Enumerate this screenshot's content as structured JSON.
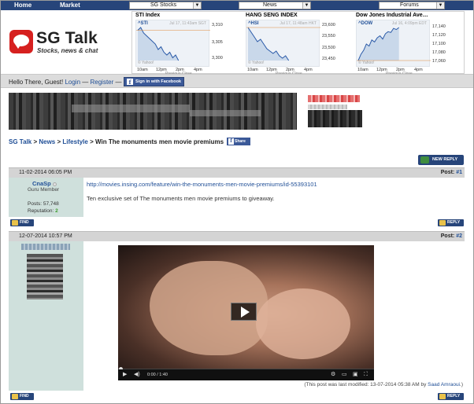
{
  "nav": {
    "home": "Home",
    "market": "Market",
    "dropdowns": [
      "SG Stocks",
      "News",
      "Forums"
    ]
  },
  "logo": {
    "title": "SG Talk",
    "tagline": "Stocks, news & chat"
  },
  "tickers": [
    {
      "title": "STI Index",
      "symbol": "^STI",
      "time": "Jul 17, 11:43am SGT",
      "y_ticks": [
        "3,310",
        "3,305",
        "3,300"
      ],
      "x_ticks": [
        "10am",
        "12pm",
        "2pm",
        "4pm"
      ],
      "prev_close": "Previous Close",
      "source": "© Yahoo!",
      "series": [
        3309,
        3310,
        3308,
        3307,
        3306,
        3305,
        3304,
        3302,
        3303,
        3301,
        3300,
        3301,
        3299,
        3300,
        3298
      ]
    },
    {
      "title": "HANG SENG INDEX",
      "symbol": "^HSI",
      "time": "Jul 17, 11:48am HKT",
      "y_ticks": [
        "23,600",
        "23,550",
        "23,500",
        "23,450"
      ],
      "x_ticks": [
        "10am",
        "12pm",
        "2pm",
        "4pm"
      ],
      "prev_close": "Previous Close",
      "source": "© Yahoo!",
      "series": [
        23580,
        23560,
        23540,
        23520,
        23530,
        23510,
        23490,
        23480,
        23470,
        23480,
        23460,
        23450,
        23460,
        23440
      ]
    },
    {
      "title": "Dow Jones Industrial Ave…",
      "symbol": "^DOW",
      "time": "Jul 16, 4:09pm EDT",
      "y_ticks": [
        "17,140",
        "17,120",
        "17,100",
        "17,080",
        "17,060"
      ],
      "x_ticks": [
        "10am",
        "12pm",
        "2pm",
        "4pm"
      ],
      "prev_close": "Previous Close",
      "source": "© Yahoo!",
      "series": [
        17060,
        17075,
        17085,
        17100,
        17095,
        17110,
        17105,
        17115,
        17120,
        17112,
        17125,
        17130,
        17128,
        17138,
        17135,
        17140
      ]
    }
  ],
  "greeting": {
    "hello": "Hello There, Guest!",
    "login": "Login",
    "register": "Register",
    "dash": "—",
    "fb_button": "Sign in with Facebook"
  },
  "breadcrumb": {
    "items": [
      "SG Talk",
      "News",
      "Lifestyle"
    ],
    "sep": ">",
    "current": "Win The monuments men movie premiums",
    "share": "Share"
  },
  "buttons": {
    "new_reply": "NEW REPLY",
    "find": "FIND",
    "reply": "REPLY"
  },
  "posts": [
    {
      "date": "11-02-2014 06:05 PM",
      "post_label": "Post:",
      "post_number": "#1",
      "username": "CnaSp",
      "role": "Guru Member",
      "posts_label": "Posts: 57,748",
      "reputation_label": "Reputation:",
      "reputation_value": "2",
      "link": "http://movies.insing.com/feature/win-the-monuments-men-movie-premiums/id-55393101",
      "text": "Ten exclusive set of The monuments men movie premiums to giveaway."
    },
    {
      "date": "12-07-2014 10:57 PM",
      "post_label": "Post:",
      "post_number": "#2",
      "video_time": "0:00 / 1:40",
      "last_modified_prefix": "(This post was last modified: 13-07-2014 05:38 AM by",
      "last_modified_user": "Saad Amraoui",
      "last_modified_suffix": ".)"
    }
  ],
  "colors": {
    "nav_bg": "#27457a",
    "link": "#1f4e96",
    "user_col": "#cfe0dc",
    "post_head": "#d4d4d4",
    "facebook": "#3b5998"
  }
}
